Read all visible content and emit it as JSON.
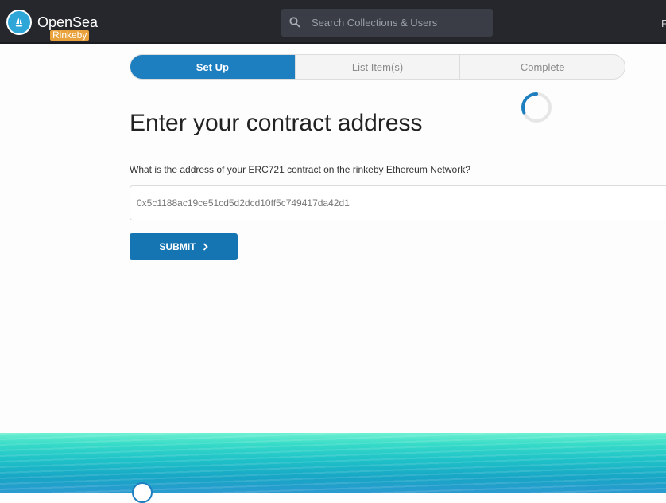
{
  "header": {
    "brand": "OpenSea",
    "network_badge": "Rinkeby",
    "search_placeholder": "Search Collections & Users",
    "cut_text": "F"
  },
  "steps": [
    {
      "label": "Set Up",
      "active": true
    },
    {
      "label": "List Item(s)",
      "active": false
    },
    {
      "label": "Complete",
      "active": false
    }
  ],
  "main": {
    "title": "Enter your contract address",
    "prompt": "What is the address of your ERC721 contract on the rinkeby Ethereum Network?",
    "address_value": "0x5c1188ac19ce51cd5d2dcd10ff5c749417da42d1",
    "submit_label": "SUBMIT"
  },
  "colors": {
    "accent": "#1e7fc0",
    "topbar": "#25272d",
    "network_badge": "#e9a23b"
  },
  "icons": [
    "opensea-logo-icon",
    "search-icon",
    "loading-spinner-icon",
    "chevron-right-icon"
  ]
}
